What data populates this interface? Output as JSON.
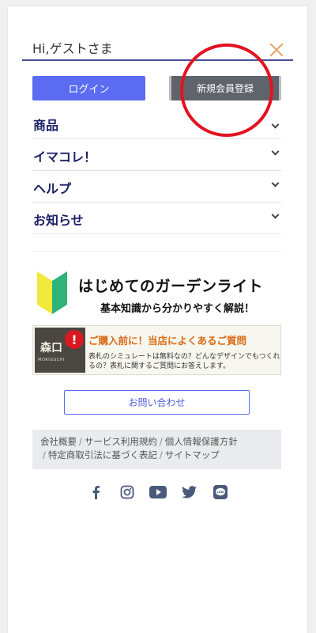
{
  "header": {
    "greeting": "Hi,ゲストさま"
  },
  "auth": {
    "login_label": "ログイン",
    "register_label": "新規会員登録"
  },
  "menu": {
    "items": [
      {
        "label": "商品"
      },
      {
        "label": "イマコレ！"
      },
      {
        "label": "ヘルプ"
      },
      {
        "label": "お知らせ"
      }
    ]
  },
  "guide_banner": {
    "title": "はじめてのガーデンライト",
    "subtitle": "基本知識から分かりやすく解説！"
  },
  "faq_banner": {
    "stone_text": "森口",
    "stone_sub": "MORIGUCHI",
    "title": "ご購入前に！当店によくあるご質問",
    "description": "表札のシミュレートは無料なの？どんなデザインでもつくれるの？表札に関するご質問にお答えします。"
  },
  "contact": {
    "label": "お問い合わせ"
  },
  "footer_links": [
    "会社概要",
    "サービス利用規約",
    "個人情報保護方針",
    "特定商取引法に基づく表記",
    "サイトマップ"
  ],
  "social_icons": [
    "facebook-icon",
    "instagram-icon",
    "youtube-icon",
    "twitter-icon",
    "line-icon"
  ],
  "colors": {
    "accent": "#5b6cf2",
    "menu_text": "#1c1f66",
    "register_bg": "#5f646c",
    "annotation_circle": "#e4121f",
    "close_icon": "#e8a060",
    "social_icon": "#4a5a7a"
  }
}
